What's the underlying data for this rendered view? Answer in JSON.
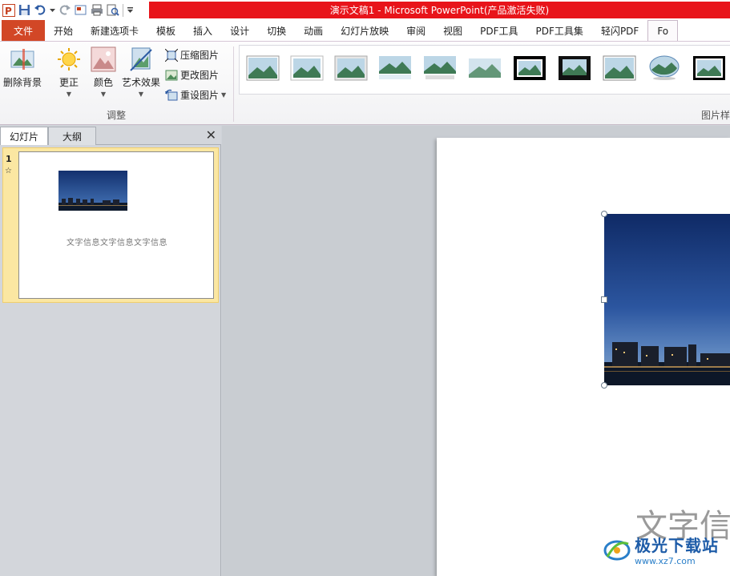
{
  "titlebar": {
    "title": "演示文稿1 - Microsoft PowerPoint(产品激活失败)",
    "accent": "#e8141a"
  },
  "tabs": [
    "文件",
    "开始",
    "新建选项卡",
    "模板",
    "插入",
    "设计",
    "切换",
    "动画",
    "幻灯片放映",
    "审阅",
    "视图",
    "PDF工具",
    "PDF工具集",
    "轻闪PDF",
    "Fo"
  ],
  "ribbon": {
    "remove_background": "删除背景",
    "corrections": "更正",
    "color": "颜色",
    "artistic_effects": "艺术效果",
    "compress": "压缩图片",
    "change": "更改图片",
    "reset": "重设图片",
    "adjust_group": "调整",
    "styles_group": "图片样"
  },
  "left_panel": {
    "tab_slides": "幻灯片",
    "tab_outline": "大纲",
    "close_icon": "close-icon",
    "slide_number": "1",
    "slide_star": "☆",
    "thumb_text": "文字信息文字信息文字信息"
  },
  "slide": {
    "text": "文字信"
  },
  "watermark": {
    "name": "极光下载站",
    "url": "www.xz7.com"
  },
  "colors": {
    "file_tab": "#d24726",
    "selection": "#fbe7a2"
  }
}
